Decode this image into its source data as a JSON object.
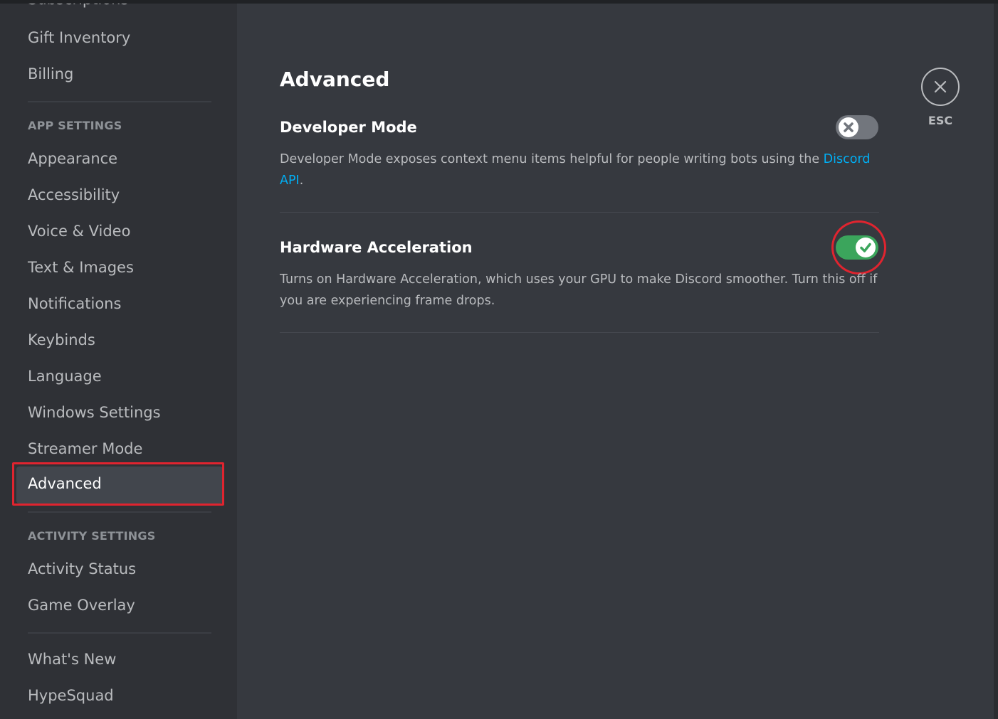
{
  "sidebar": {
    "cut_item": "Subscriptions",
    "user_items": [
      "Gift Inventory",
      "Billing"
    ],
    "app_settings_header": "APP SETTINGS",
    "app_items": [
      "Appearance",
      "Accessibility",
      "Voice & Video",
      "Text & Images",
      "Notifications",
      "Keybinds",
      "Language",
      "Windows Settings",
      "Streamer Mode"
    ],
    "active_item": "Advanced",
    "activity_settings_header": "ACTIVITY SETTINGS",
    "activity_items": [
      "Activity Status",
      "Game Overlay"
    ],
    "misc_items": [
      "What's New",
      "HypeSquad"
    ]
  },
  "main": {
    "title": "Advanced",
    "developer_mode": {
      "title": "Developer Mode",
      "desc_prefix": "Developer Mode exposes context menu items helpful for people writing bots using the ",
      "link_part1": "Discord",
      "link_part2": "API",
      "desc_suffix": ".",
      "enabled": false
    },
    "hardware_acceleration": {
      "title": "Hardware Acceleration",
      "desc_line1": "Turns on Hardware Acceleration, which uses your GPU to make Discord smoother. Turn this off if",
      "desc_line2": "you are experiencing frame drops.",
      "enabled": true
    }
  },
  "close": {
    "label": "ESC"
  },
  "colors": {
    "background": "#36393f",
    "sidebar": "#2f3136",
    "accent_link": "#00aff4",
    "toggle_on": "#3ba55c",
    "toggle_off": "#72767d",
    "annotation_red": "#e0242f"
  }
}
